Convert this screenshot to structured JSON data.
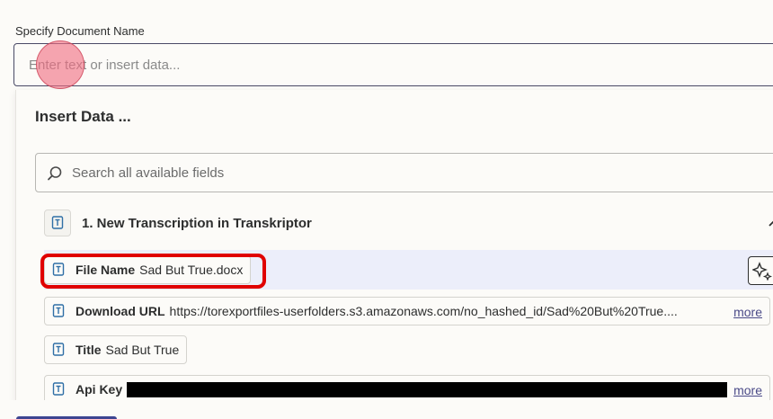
{
  "form": {
    "field_label": "Specify Document Name",
    "input_placeholder": "Enter text or insert data...",
    "input_value": ""
  },
  "insert_panel": {
    "title": "Insert Data ...",
    "search_placeholder": "Search all available fields",
    "step": {
      "title": "1. New Transcription in Transkriptor",
      "fields": [
        {
          "key": "File Name",
          "value": "Sad But True.docx",
          "more": ""
        },
        {
          "key": "Download URL",
          "value": "https://torexportfiles-userfolders.s3.amazonaws.com/no_hashed_id/Sad%20But%20True....",
          "more": "more"
        },
        {
          "key": "Title",
          "value": "Sad But True",
          "more": ""
        },
        {
          "key": "Api Key",
          "value": "",
          "more": "more"
        }
      ]
    }
  },
  "colors": {
    "highlight_row": "#eceefa",
    "annotation_outline": "#e00000",
    "link": "#4a4a88",
    "cursor": "#f06e82"
  },
  "icons": {
    "search": "search-icon",
    "text_field": "text-type-icon",
    "chevron": "chevron-up-icon",
    "ai": "sparkle-icon"
  }
}
